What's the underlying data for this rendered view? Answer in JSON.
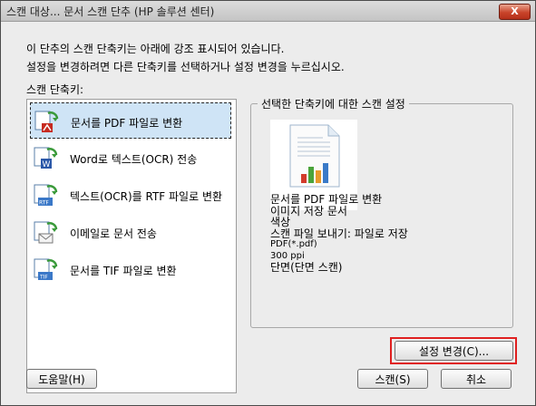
{
  "window": {
    "title": "스캔 대상... 문서 스캔 단추 (HP 솔루션 센터)",
    "close_label": "X"
  },
  "instructions": {
    "line1": "이 단추의 스캔 단축키는 아래에 강조 표시되어 있습니다.",
    "line2": "설정을 변경하려면 다른 단축키를 선택하거나 설정 변경을 누르십시오."
  },
  "shortcut_list": {
    "label": "스캔 단축키:",
    "items": [
      {
        "label": "문서를 PDF 파일로 변환",
        "icon": "pdf-doc-icon",
        "selected": true
      },
      {
        "label": "Word로 텍스트(OCR) 전송",
        "icon": "word-doc-icon",
        "selected": false
      },
      {
        "label": "텍스트(OCR)를 RTF 파일로 변환",
        "icon": "rtf-doc-icon",
        "selected": false
      },
      {
        "label": "이메일로 문서 전송",
        "icon": "email-doc-icon",
        "selected": false
      },
      {
        "label": "문서를 TIF 파일로 변환",
        "icon": "tif-doc-icon",
        "selected": false
      }
    ]
  },
  "settings_panel": {
    "title": "선택한 단축키에 대한 스캔 설정",
    "lines": [
      "문서를 PDF 파일로 변환",
      "이미지 저장 문서",
      "색상",
      "스캔 파일 보내기: 파일로 저장",
      "PDF(*.pdf)",
      "300 ppi",
      "단면(단면 스캔)"
    ]
  },
  "buttons": {
    "change_settings": "설정 변경(C)...",
    "help": "도움말(H)",
    "scan": "스캔(S)",
    "cancel": "취소"
  },
  "colors": {
    "selection": "#cfe4f6",
    "highlight_box": "#e02020",
    "dialog_bg": "#ececec"
  }
}
